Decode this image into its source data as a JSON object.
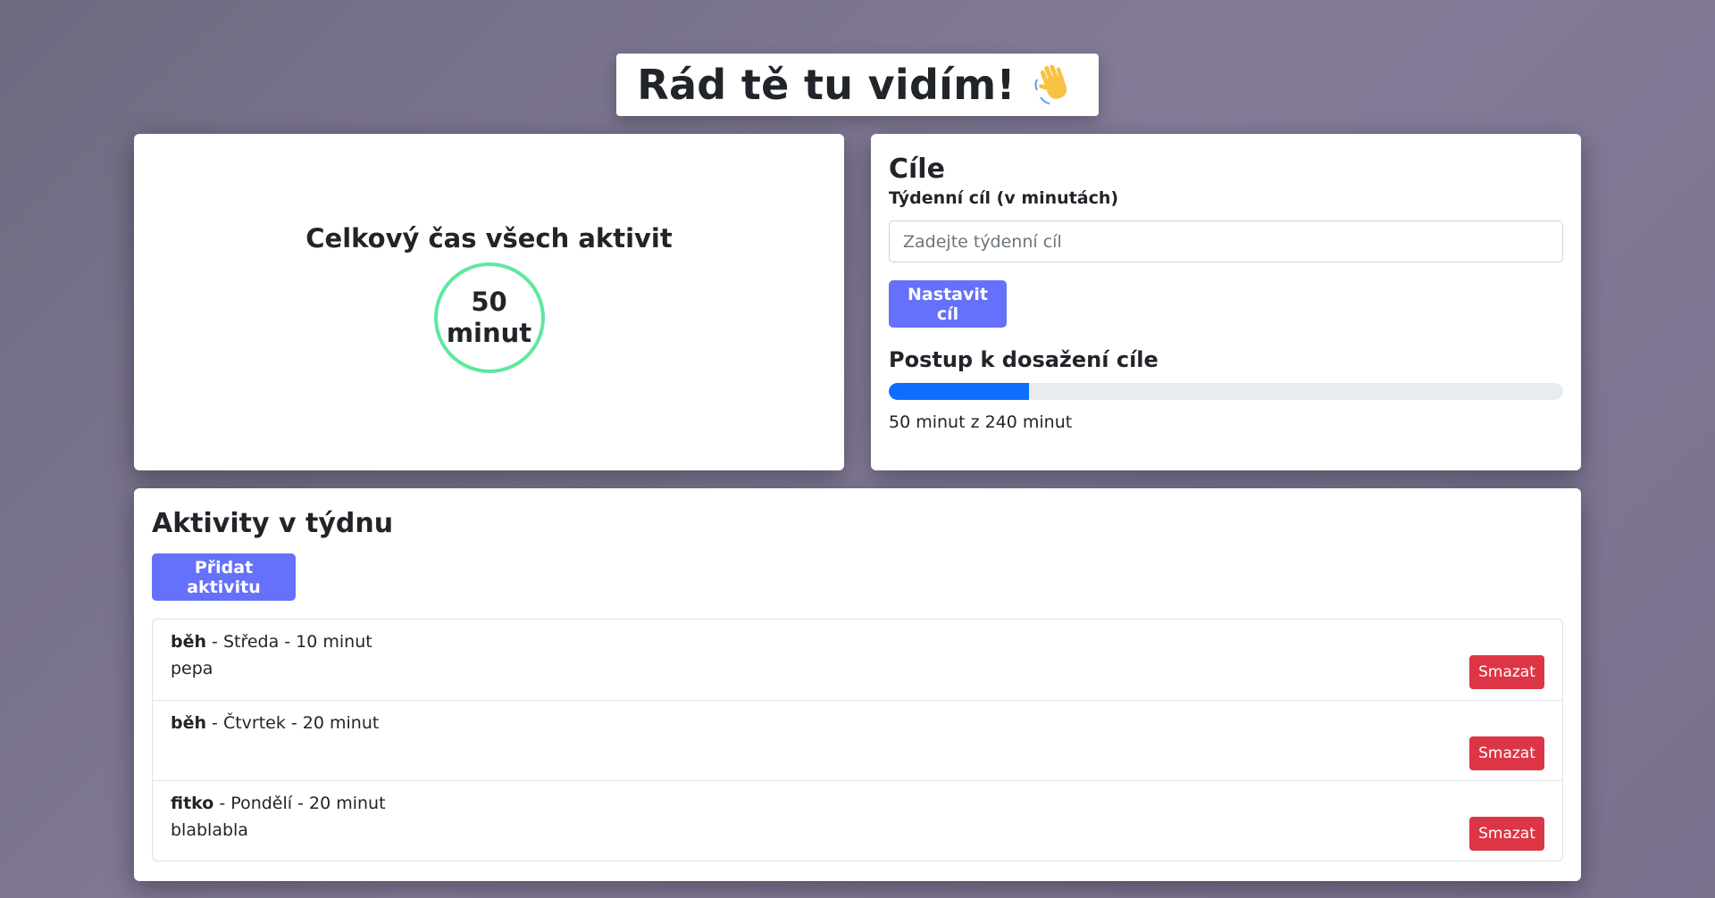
{
  "header": {
    "title": "Rád tě tu vidím!",
    "icon": "waving-hand-icon"
  },
  "total_card": {
    "title": "Celkový čas všech aktivit",
    "value": "50",
    "unit": "minut",
    "ring_color": "#5ee89e"
  },
  "goals_card": {
    "title": "Cíle",
    "weekly_goal_label": "Týdenní cíl (v minutách)",
    "weekly_goal_input": {
      "value": "",
      "placeholder": "Zadejte týdenní cíl"
    },
    "set_goal_button": "Nastavit cíl",
    "progress_title": "Postup k dosažení cíle",
    "progress_value": 50,
    "progress_max": 240,
    "progress_text": "50 minut z 240 minut",
    "progress_color": "#0d6efd"
  },
  "activities_card": {
    "title": "Aktivity v týdnu",
    "add_button": "Přidat aktivitu",
    "delete_label": "Smazat",
    "items": [
      {
        "name": "běh",
        "details": " - Středa - 10 minut",
        "note": "pepa"
      },
      {
        "name": "běh",
        "details": " - Čtvrtek - 20 minut",
        "note": ""
      },
      {
        "name": "fitko",
        "details": " - Pondělí - 20 minut",
        "note": "blablabla"
      }
    ]
  },
  "colors": {
    "primary_button": "#6571fa",
    "danger_button": "#dc3545"
  }
}
